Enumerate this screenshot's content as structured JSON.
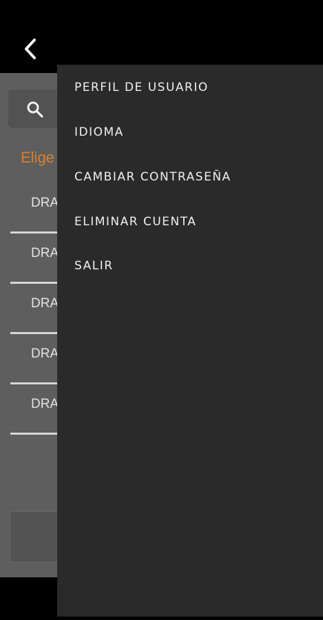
{
  "header": {
    "back_icon": "chevron-left-icon"
  },
  "background": {
    "search_icon": "search-icon",
    "choose_label": "Elige",
    "items": [
      {
        "label": "DRA"
      },
      {
        "label": "DRA"
      },
      {
        "label": "DRA"
      },
      {
        "label": "DRA"
      },
      {
        "label": "DRA"
      }
    ],
    "accent_color": "#d68030"
  },
  "menu": {
    "items": [
      {
        "label": "PERFIL DE USUARIO"
      },
      {
        "label": "IDIOMA"
      },
      {
        "label": "CAMBIAR CONTRASEÑA"
      },
      {
        "label": "ELIMINAR CUENTA"
      },
      {
        "label": "SALIR"
      }
    ]
  }
}
